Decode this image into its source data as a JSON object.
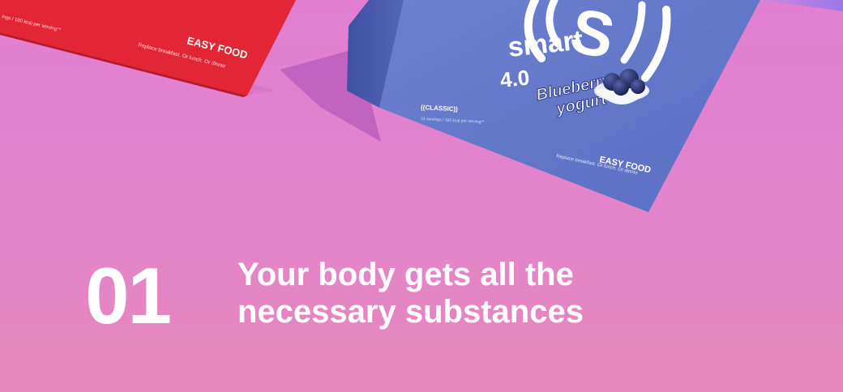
{
  "colors": {
    "background_top": "#e27fd2",
    "background_bottom": "#e688bd",
    "red_box": "#e32635",
    "blue_box": "#5f74c6",
    "text": "#ffffff"
  },
  "red_box": {
    "serving_note": "ings / 180 kcal per serving**",
    "brand": "EASY FOOD",
    "tagline": "Replace breakfast. Or lunch. Or dinner"
  },
  "blue_box": {
    "logo_letter": "S",
    "product_name": "smart",
    "version": "4.0",
    "flavor_line1": "Blueberry",
    "flavor_line2": "yogurt",
    "edition": "((CLASSIC))",
    "serving_note": "15 servings / 180 kcal per serving**",
    "brand": "EASY FOOD",
    "tagline": "Replace breakfast. Or lunch. Or dinner"
  },
  "step": {
    "number": "01",
    "line1": "Your body gets all the",
    "line2": "necessary substances"
  }
}
